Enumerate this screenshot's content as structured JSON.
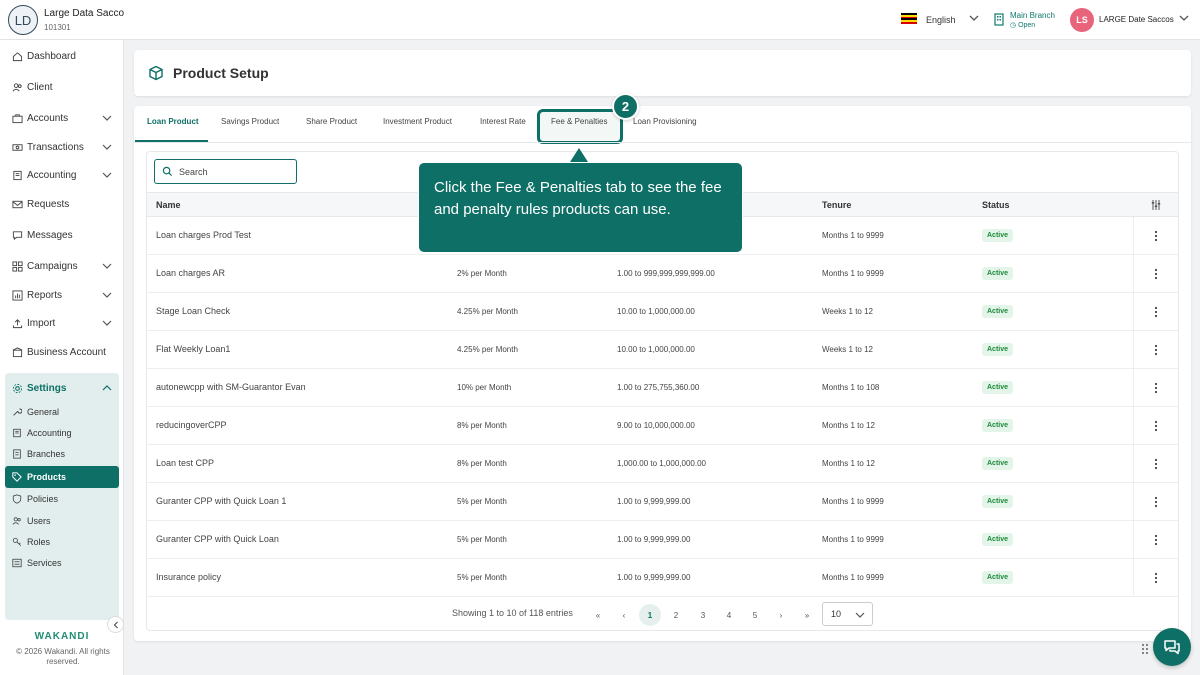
{
  "header": {
    "org_initials": "LD",
    "org_name": "Large Data Sacco",
    "org_code": "101301",
    "language": "English",
    "branch_name": "Main Branch",
    "branch_status": "Open",
    "user_initials": "LS",
    "user_name": "LARGE Date Saccos"
  },
  "sidebar": {
    "items": [
      {
        "label": "Dashboard",
        "icon": "home-icon"
      },
      {
        "label": "Client",
        "icon": "users-icon"
      },
      {
        "label": "Accounts",
        "icon": "briefcase-icon"
      },
      {
        "label": "Transactions",
        "icon": "money-icon"
      },
      {
        "label": "Accounting",
        "icon": "book-icon"
      },
      {
        "label": "Requests",
        "icon": "mail-icon"
      },
      {
        "label": "Messages",
        "icon": "chat-icon"
      },
      {
        "label": "Campaigns",
        "icon": "grid-icon"
      },
      {
        "label": "Reports",
        "icon": "chart-icon"
      },
      {
        "label": "Import",
        "icon": "upload-icon"
      },
      {
        "label": "Business Account",
        "icon": "building-icon"
      }
    ],
    "settings_label": "Settings",
    "settings_items": [
      {
        "label": "General"
      },
      {
        "label": "Accounting"
      },
      {
        "label": "Branches"
      },
      {
        "label": "Products"
      },
      {
        "label": "Policies"
      },
      {
        "label": "Users"
      },
      {
        "label": "Roles"
      },
      {
        "label": "Services"
      }
    ],
    "brand": "WAKANDI",
    "copyright": "© 2026 Wakandi. All rights reserved."
  },
  "page": {
    "title": "Product Setup"
  },
  "tabs": [
    {
      "label": "Loan Product"
    },
    {
      "label": "Savings Product"
    },
    {
      "label": "Share Product"
    },
    {
      "label": "Investment Product"
    },
    {
      "label": "Interest Rate"
    },
    {
      "label": "Fee & Penalties"
    },
    {
      "label": "Loan Provisioning"
    }
  ],
  "search": {
    "placeholder": "Search"
  },
  "table": {
    "columns": [
      "Name",
      "Tenure",
      "Status"
    ],
    "rows": [
      {
        "name": "Loan charges Prod Test",
        "rate": "",
        "amount": "",
        "tenure": "Months 1 to 9999",
        "status": "Active"
      },
      {
        "name": "Loan charges AR",
        "rate": "2% per Month",
        "amount": "1.00 to 999,999,999,999.00",
        "tenure": "Months 1 to 9999",
        "status": "Active"
      },
      {
        "name": "Stage Loan Check",
        "rate": "4.25% per Month",
        "amount": "10.00 to 1,000,000.00",
        "tenure": "Weeks 1 to 12",
        "status": "Active"
      },
      {
        "name": "Flat Weekly Loan1",
        "rate": "4.25% per Month",
        "amount": "10.00 to 1,000,000.00",
        "tenure": "Weeks 1 to 12",
        "status": "Active"
      },
      {
        "name": "autonewcpp with SM-Guarantor Evan",
        "rate": "10% per Month",
        "amount": "1.00 to 275,755,360.00",
        "tenure": "Months 1 to 108",
        "status": "Active"
      },
      {
        "name": "reducingoverCPP",
        "rate": "8% per Month",
        "amount": "9.00 to 10,000,000.00",
        "tenure": "Months 1 to 12",
        "status": "Active"
      },
      {
        "name": "Loan test CPP",
        "rate": "8% per Month",
        "amount": "1,000.00 to 1,000,000.00",
        "tenure": "Months 1 to 12",
        "status": "Active"
      },
      {
        "name": "Guranter CPP with Quick Loan 1",
        "rate": "5% per Month",
        "amount": "1.00 to 9,999,999.00",
        "tenure": "Months 1 to 9999",
        "status": "Active"
      },
      {
        "name": "Guranter CPP with Quick Loan",
        "rate": "5% per Month",
        "amount": "1.00 to 9,999,999.00",
        "tenure": "Months 1 to 9999",
        "status": "Active"
      },
      {
        "name": "Insurance policy",
        "rate": "5% per Month",
        "amount": "1.00 to 9,999,999.00",
        "tenure": "Months 1 to 9999",
        "status": "Active"
      }
    ]
  },
  "pagination": {
    "info": "Showing 1 to 10 of 118 entries",
    "pages": [
      "1",
      "2",
      "3",
      "4",
      "5"
    ],
    "current": "1",
    "page_size": "10"
  },
  "tour": {
    "step": "2",
    "text": "Click the Fee & Penalties tab to see the fee and penalty rules products can use."
  },
  "colors": {
    "primary": "#0e6f66",
    "active_badge": "#1d8a3c",
    "user_avatar": "#e8647a"
  }
}
